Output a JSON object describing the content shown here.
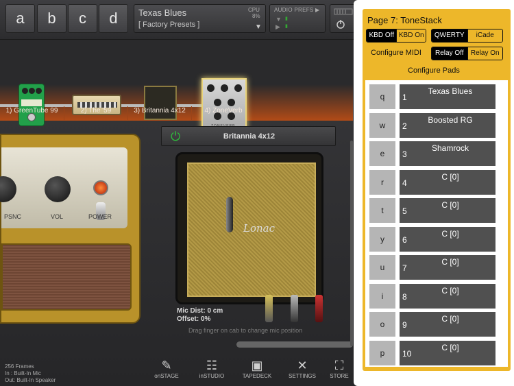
{
  "top_bar": {
    "preset_keys": [
      "a",
      "b",
      "c",
      "d"
    ],
    "preset_name": "Texas Blues",
    "preset_bank": "[ Factory Presets ]",
    "cpu_label": "CPU",
    "cpu_value": "8%",
    "audio_prefs_label": "AUDIO PREFS ▶"
  },
  "signal_chain": {
    "slots": [
      "1) GreenTube 99",
      "2) The '59",
      "3) Britannia 4x12",
      "4) ZoneVerb"
    ],
    "reverb_text": "ZONEVERB"
  },
  "amp": {
    "knob_labels": [
      "PSNC",
      "VOL",
      "POWER"
    ]
  },
  "cabinet": {
    "title": "Britannia 4x12",
    "logo": "Lonac",
    "mic_dist": "Mic Dist: 0 cm",
    "offset": "Offset: 0%",
    "drag_hint": "Drag finger on cab to change mic position"
  },
  "status": {
    "frames": "256 Frames",
    "input": "In   : Built-In Mic",
    "output": "Out: Built-In Speaker"
  },
  "nav": [
    "onSTAGE",
    "inSTUDIO",
    "TAPEDECK",
    "SETTINGS",
    "STORE"
  ],
  "tonestack": {
    "title": "Page 7: ToneStack",
    "kbd_off": "KBD Off",
    "kbd_on": "KBD On",
    "qwerty": "QWERTY",
    "icade": "iCade",
    "configure_midi": "Configure MIDI",
    "relay_off": "Relay Off",
    "relay_on": "Relay On",
    "configure_pads": "Configure Pads",
    "pads": [
      {
        "key": "q",
        "num": "1",
        "name": "Texas Blues"
      },
      {
        "key": "w",
        "num": "2",
        "name": "Boosted RG"
      },
      {
        "key": "e",
        "num": "3",
        "name": "Shamrock"
      },
      {
        "key": "r",
        "num": "4",
        "name": "C [0]"
      },
      {
        "key": "t",
        "num": "5",
        "name": "C [0]"
      },
      {
        "key": "y",
        "num": "6",
        "name": "C [0]"
      },
      {
        "key": "u",
        "num": "7",
        "name": "C [0]"
      },
      {
        "key": "i",
        "num": "8",
        "name": "C [0]"
      },
      {
        "key": "o",
        "num": "9",
        "name": "C [0]"
      },
      {
        "key": "p",
        "num": "10",
        "name": "C [0]"
      }
    ]
  },
  "colors": {
    "accent": "#edb72a",
    "chain_highlight": "#b24b17",
    "power_green": "#2fba3c"
  }
}
